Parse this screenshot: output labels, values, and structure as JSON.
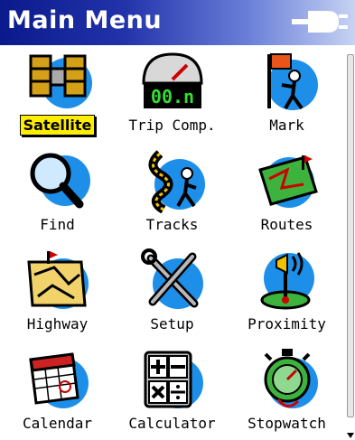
{
  "header": {
    "title": "Main Menu",
    "icon": "power-plug-icon"
  },
  "menu": {
    "items": [
      {
        "label": "Satellite",
        "icon": "satellite-icon",
        "selected": true
      },
      {
        "label": "Trip Comp.",
        "icon": "trip-computer-icon",
        "readout": "00.n",
        "selected": false
      },
      {
        "label": "Mark",
        "icon": "mark-waypoint-icon",
        "selected": false
      },
      {
        "label": "Find",
        "icon": "magnifier-icon",
        "selected": false
      },
      {
        "label": "Tracks",
        "icon": "tracks-icon",
        "selected": false
      },
      {
        "label": "Routes",
        "icon": "routes-icon",
        "selected": false
      },
      {
        "label": "Highway",
        "icon": "highway-icon",
        "selected": false
      },
      {
        "label": "Setup",
        "icon": "wrench-icon",
        "selected": false
      },
      {
        "label": "Proximity",
        "icon": "proximity-alarm-icon",
        "selected": false
      },
      {
        "label": "Calendar",
        "icon": "calendar-icon",
        "selected": false
      },
      {
        "label": "Calculator",
        "icon": "calculator-icon",
        "selected": false
      },
      {
        "label": "Stopwatch",
        "icon": "stopwatch-icon",
        "selected": false
      }
    ]
  },
  "colors": {
    "titlebar_dark": "#0a1a8c",
    "titlebar_light": "#c7d3f3",
    "highlight": "#ffee00",
    "icon_ring": "#1e8fe8"
  }
}
